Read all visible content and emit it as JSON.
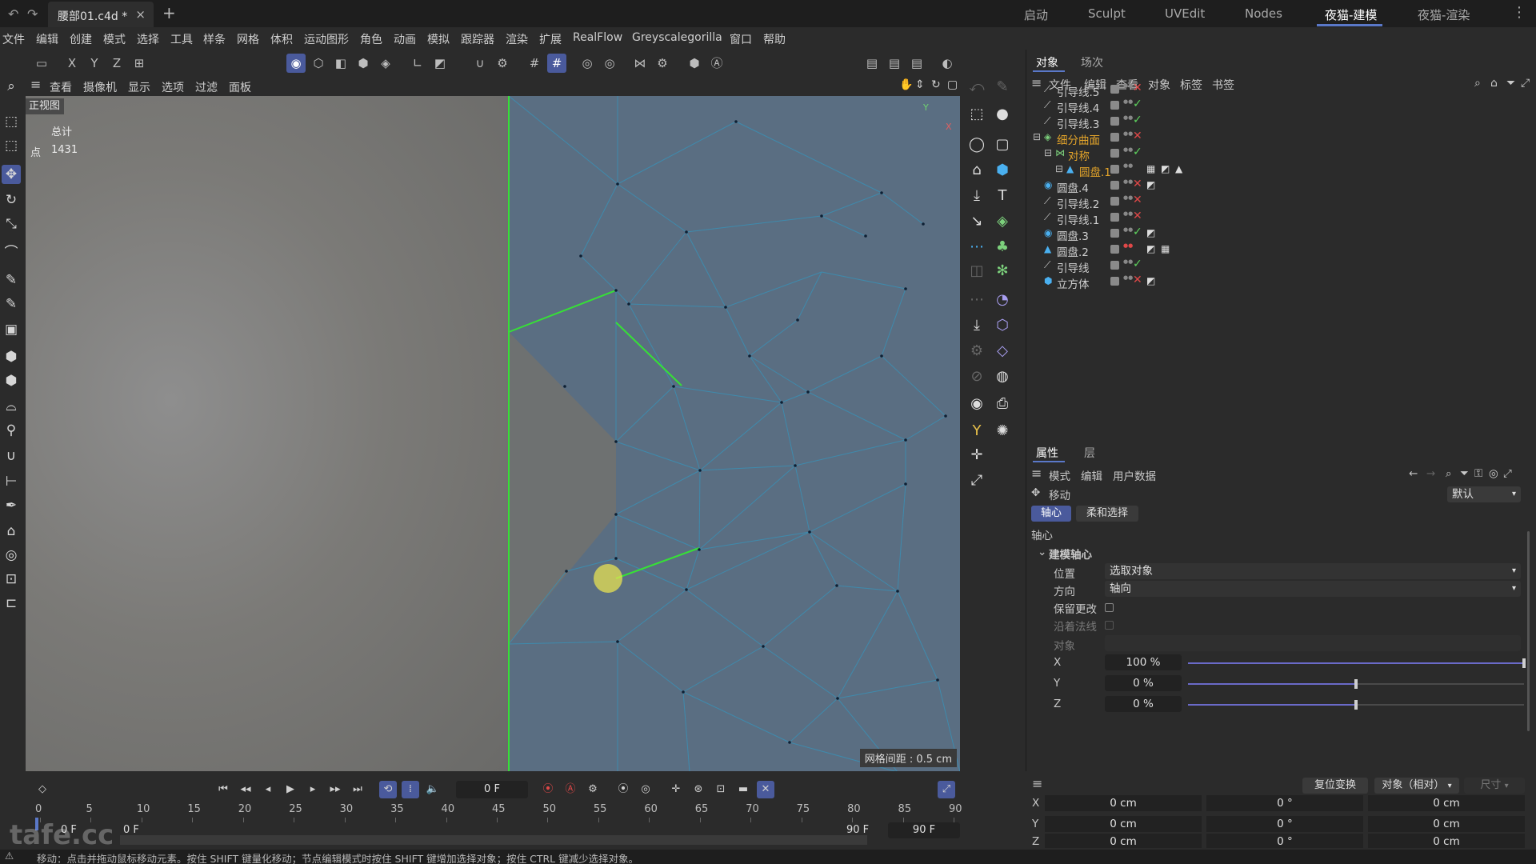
{
  "titlebar": {
    "doc_tab": "腰部01.c4d *",
    "layouts": [
      "启动",
      "Sculpt",
      "UVEdit",
      "Nodes",
      "夜猫-建模",
      "夜猫-渲染"
    ],
    "active_layout": "夜猫-建模"
  },
  "menubar": [
    "文件",
    "编辑",
    "创建",
    "模式",
    "选择",
    "工具",
    "样条",
    "网格",
    "体积",
    "运动图形",
    "角色",
    "动画",
    "模拟",
    "跟踪器",
    "渲染",
    "扩展",
    "RealFlow",
    "Greyscalegorilla",
    "窗口",
    "帮助"
  ],
  "toolbar": {
    "axis_x": "X",
    "axis_y": "Y",
    "axis_z": "Z"
  },
  "viewport": {
    "menu": [
      "查看",
      "摄像机",
      "显示",
      "选项",
      "过滤",
      "面板"
    ],
    "view_name": "正视图",
    "stats_total_label": "总计",
    "stats_points_label": "点",
    "stats_points_value": "1431",
    "grid_spacing": "网格间距 : 0.5 cm",
    "axis_y": "Y",
    "axis_x": "X"
  },
  "object_manager": {
    "tabs": [
      "对象",
      "场次"
    ],
    "active_tab": "对象",
    "menu": [
      "文件",
      "编辑",
      "查看",
      "对象",
      "标签",
      "书签"
    ],
    "objects": [
      {
        "name": "引导线.5",
        "icon": "spline-icon",
        "indent": 0,
        "status": "no",
        "highlight": false
      },
      {
        "name": "引导线.4",
        "icon": "spline-icon",
        "indent": 0,
        "status": "ok",
        "highlight": false
      },
      {
        "name": "引导线.3",
        "icon": "spline-icon",
        "indent": 0,
        "status": "ok",
        "highlight": false
      },
      {
        "name": "细分曲面",
        "icon": "subdivision-icon",
        "indent": 0,
        "status": "no",
        "highlight": true
      },
      {
        "name": "对称",
        "icon": "symmetry-icon",
        "indent": 1,
        "status": "ok",
        "highlight": true
      },
      {
        "name": "圆盘.1",
        "icon": "polygon-icon",
        "indent": 2,
        "status": "none",
        "highlight": true
      },
      {
        "name": "圆盘.4",
        "icon": "disc-icon",
        "indent": 0,
        "status": "no",
        "highlight": false
      },
      {
        "name": "引导线.2",
        "icon": "spline-icon",
        "indent": 0,
        "status": "no",
        "highlight": false
      },
      {
        "name": "引导线.1",
        "icon": "spline-icon",
        "indent": 0,
        "status": "no",
        "highlight": false
      },
      {
        "name": "圆盘.3",
        "icon": "disc-icon",
        "indent": 0,
        "status": "ok",
        "highlight": false
      },
      {
        "name": "圆盘.2",
        "icon": "polygon-icon",
        "indent": 0,
        "status": "red-dot",
        "highlight": false
      },
      {
        "name": "引导线",
        "icon": "spline-icon",
        "indent": 0,
        "status": "ok",
        "highlight": false
      },
      {
        "name": "立方体",
        "icon": "cube-icon",
        "indent": 0,
        "status": "no",
        "highlight": false
      }
    ]
  },
  "attributes": {
    "tabs": [
      "属性",
      "层"
    ],
    "active_tab": "属性",
    "menu": [
      "模式",
      "编辑",
      "用户数据"
    ],
    "tool_name": "移动",
    "preset": "默认",
    "subtabs": [
      "轴心",
      "柔和选择"
    ],
    "active_subtab": "轴心",
    "section": "轴心",
    "group": "建模轴心",
    "position_label": "位置",
    "position_value": "选取对象",
    "direction_label": "方向",
    "direction_value": "轴向",
    "keep_changes_label": "保留更改",
    "along_normal_label": "沿着法线",
    "object_label": "对象",
    "x_label": "X",
    "x_value": "100 %",
    "x_fraction": 1.0,
    "y_label": "Y",
    "y_value": "0 %",
    "y_fraction": 0.5,
    "z_label": "Z",
    "z_value": "0 %",
    "z_fraction": 0.5
  },
  "coordinates": {
    "apply_button": "复位变换",
    "mode": "对象（相对）",
    "size_mode": "尺寸",
    "rows": [
      {
        "axis": "X",
        "pos": "0 cm",
        "rot": "0 °",
        "size": "0 cm"
      },
      {
        "axis": "Y",
        "pos": "0 cm",
        "rot": "0 °",
        "size": "0 cm"
      },
      {
        "axis": "Z",
        "pos": "0 cm",
        "rot": "0 °",
        "size": "0 cm"
      }
    ]
  },
  "timeline": {
    "current_frame": "0 F",
    "ticks": [
      "0",
      "5",
      "10",
      "15",
      "20",
      "25",
      "30",
      "35",
      "40",
      "45",
      "50",
      "55",
      "60",
      "65",
      "70",
      "75",
      "80",
      "85",
      "90"
    ],
    "start_frame": "0 F",
    "preview_start": "0 F",
    "preview_end": "90 F",
    "end_frame": "90 F"
  },
  "statusbar": {
    "text": "移动：点击并拖动鼠标移动元素。按住 SHIFT 键量化移动；节点编辑模式时按住 SHIFT 键增加选择对象；按住 CTRL 键减少选择对象。"
  },
  "watermark": "tafe.cc",
  "colors": {
    "accent": "#4a5a9c",
    "highlight_name": "#e2a32a",
    "ok": "#5ed35e",
    "no": "#e04848",
    "mesh_edge": "#3a8fb4",
    "selected_edge": "#36e036",
    "viewport_bg": "#5a6e82"
  }
}
